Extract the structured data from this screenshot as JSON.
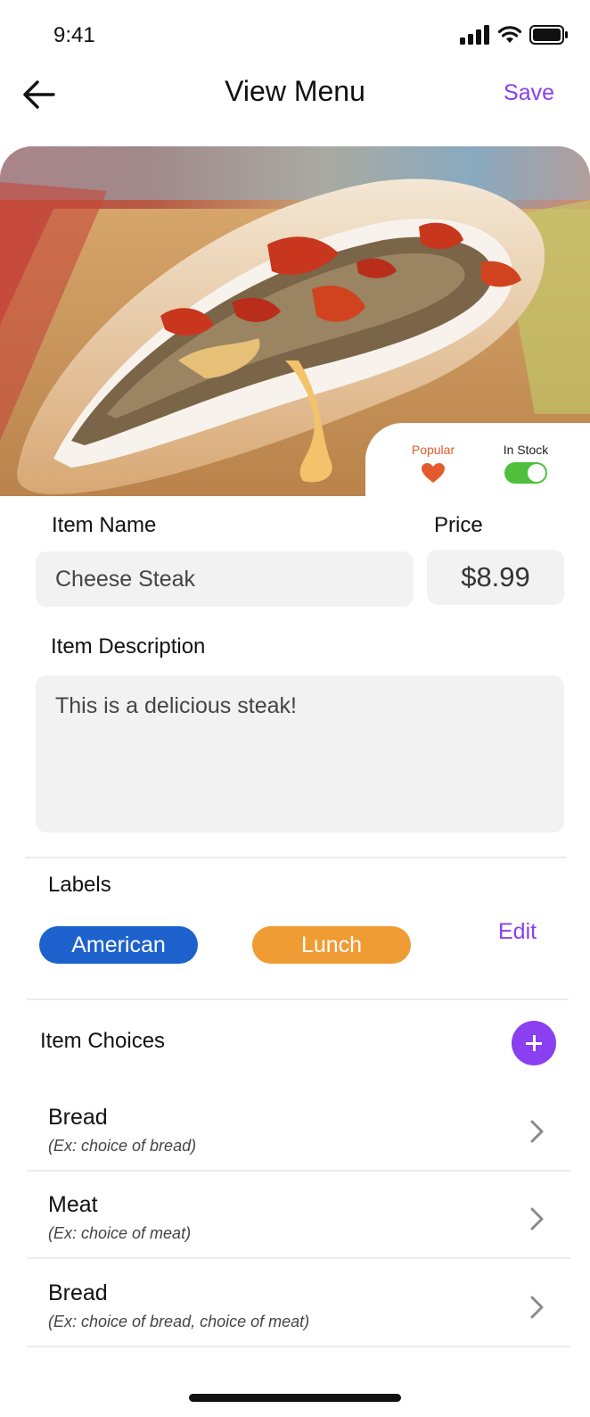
{
  "status_bar": {
    "time": "9:41"
  },
  "nav": {
    "title": "View Menu",
    "save_label": "Save",
    "back_icon": "arrow-left-icon"
  },
  "hero": {
    "image": "cheese-steak-sandwich-photo"
  },
  "flags": {
    "popular_label": "Popular",
    "popular_icon": "heart-icon",
    "popular_color": "#e35a2c",
    "in_stock_label": "In Stock",
    "in_stock": true,
    "toggle_color": "#4fbf3d"
  },
  "form": {
    "item_name_label": "Item Name",
    "item_name_value": "Cheese Steak",
    "price_label": "Price",
    "price_value": "$8.99",
    "description_label": "Item Description",
    "description_value": "This is a delicious steak!"
  },
  "labels": {
    "heading": "Labels",
    "items": [
      {
        "text": "American",
        "color": "#1d62cc"
      },
      {
        "text": "Lunch",
        "color": "#f09c35"
      }
    ],
    "edit_label": "Edit"
  },
  "choices": {
    "heading": "Item Choices",
    "add_icon": "plus-icon",
    "items": [
      {
        "title": "Bread",
        "subtitle": "(Ex: choice of bread)"
      },
      {
        "title": "Meat",
        "subtitle": "(Ex: choice of meat)"
      },
      {
        "title": "Bread",
        "subtitle": "(Ex: choice of bread, choice of meat)"
      }
    ]
  },
  "accent_color": "#8a3ff0"
}
